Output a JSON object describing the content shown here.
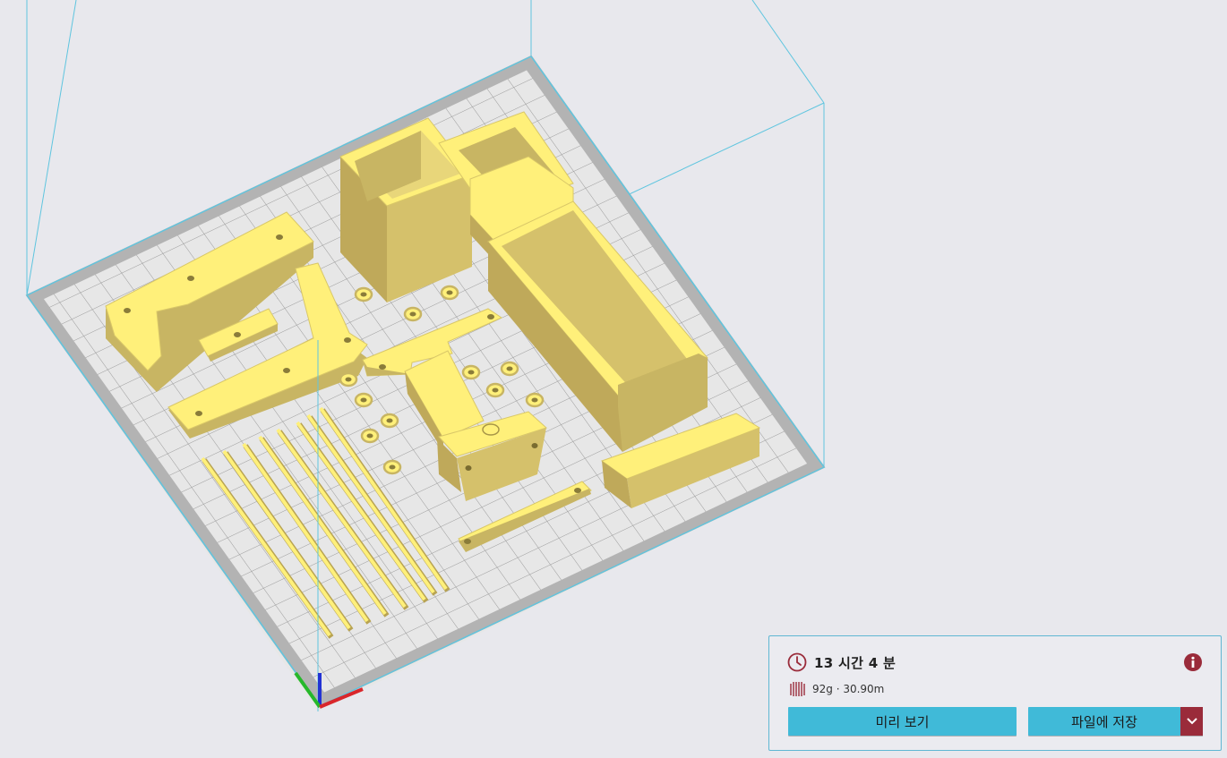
{
  "viewport": {
    "scene": "3d-build-plate",
    "accent": "#40bad8",
    "model_color": "#fff07a",
    "volume_outline_color": "#5fc5df"
  },
  "print_panel": {
    "time_icon": "clock-icon",
    "print_time": "13 시간 4 분",
    "info_icon": "info-icon",
    "material_icon": "filament-spool-icon",
    "material_usage": "92g · 30.90m",
    "preview_label": "미리 보기",
    "save_label": "파일에 저장",
    "dropdown_icon": "chevron-down-icon",
    "accent_color": "#40bad8",
    "danger_color": "#9a2b3a"
  }
}
